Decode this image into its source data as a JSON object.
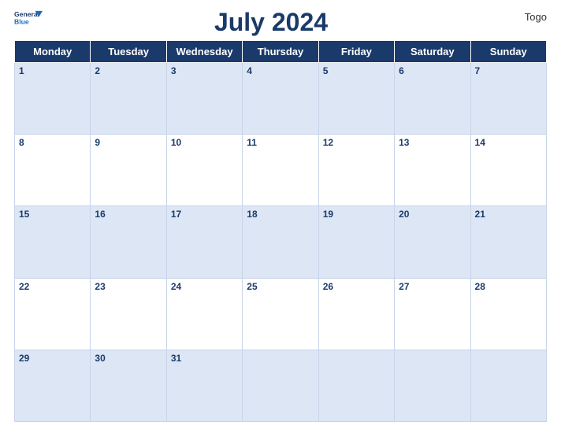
{
  "header": {
    "logo_general": "General",
    "logo_blue": "Blue",
    "title": "July 2024",
    "country": "Togo"
  },
  "weekdays": [
    "Monday",
    "Tuesday",
    "Wednesday",
    "Thursday",
    "Friday",
    "Saturday",
    "Sunday"
  ],
  "weeks": [
    [
      1,
      2,
      3,
      4,
      5,
      6,
      7
    ],
    [
      8,
      9,
      10,
      11,
      12,
      13,
      14
    ],
    [
      15,
      16,
      17,
      18,
      19,
      20,
      21
    ],
    [
      22,
      23,
      24,
      25,
      26,
      27,
      28
    ],
    [
      29,
      30,
      31,
      null,
      null,
      null,
      null
    ]
  ]
}
